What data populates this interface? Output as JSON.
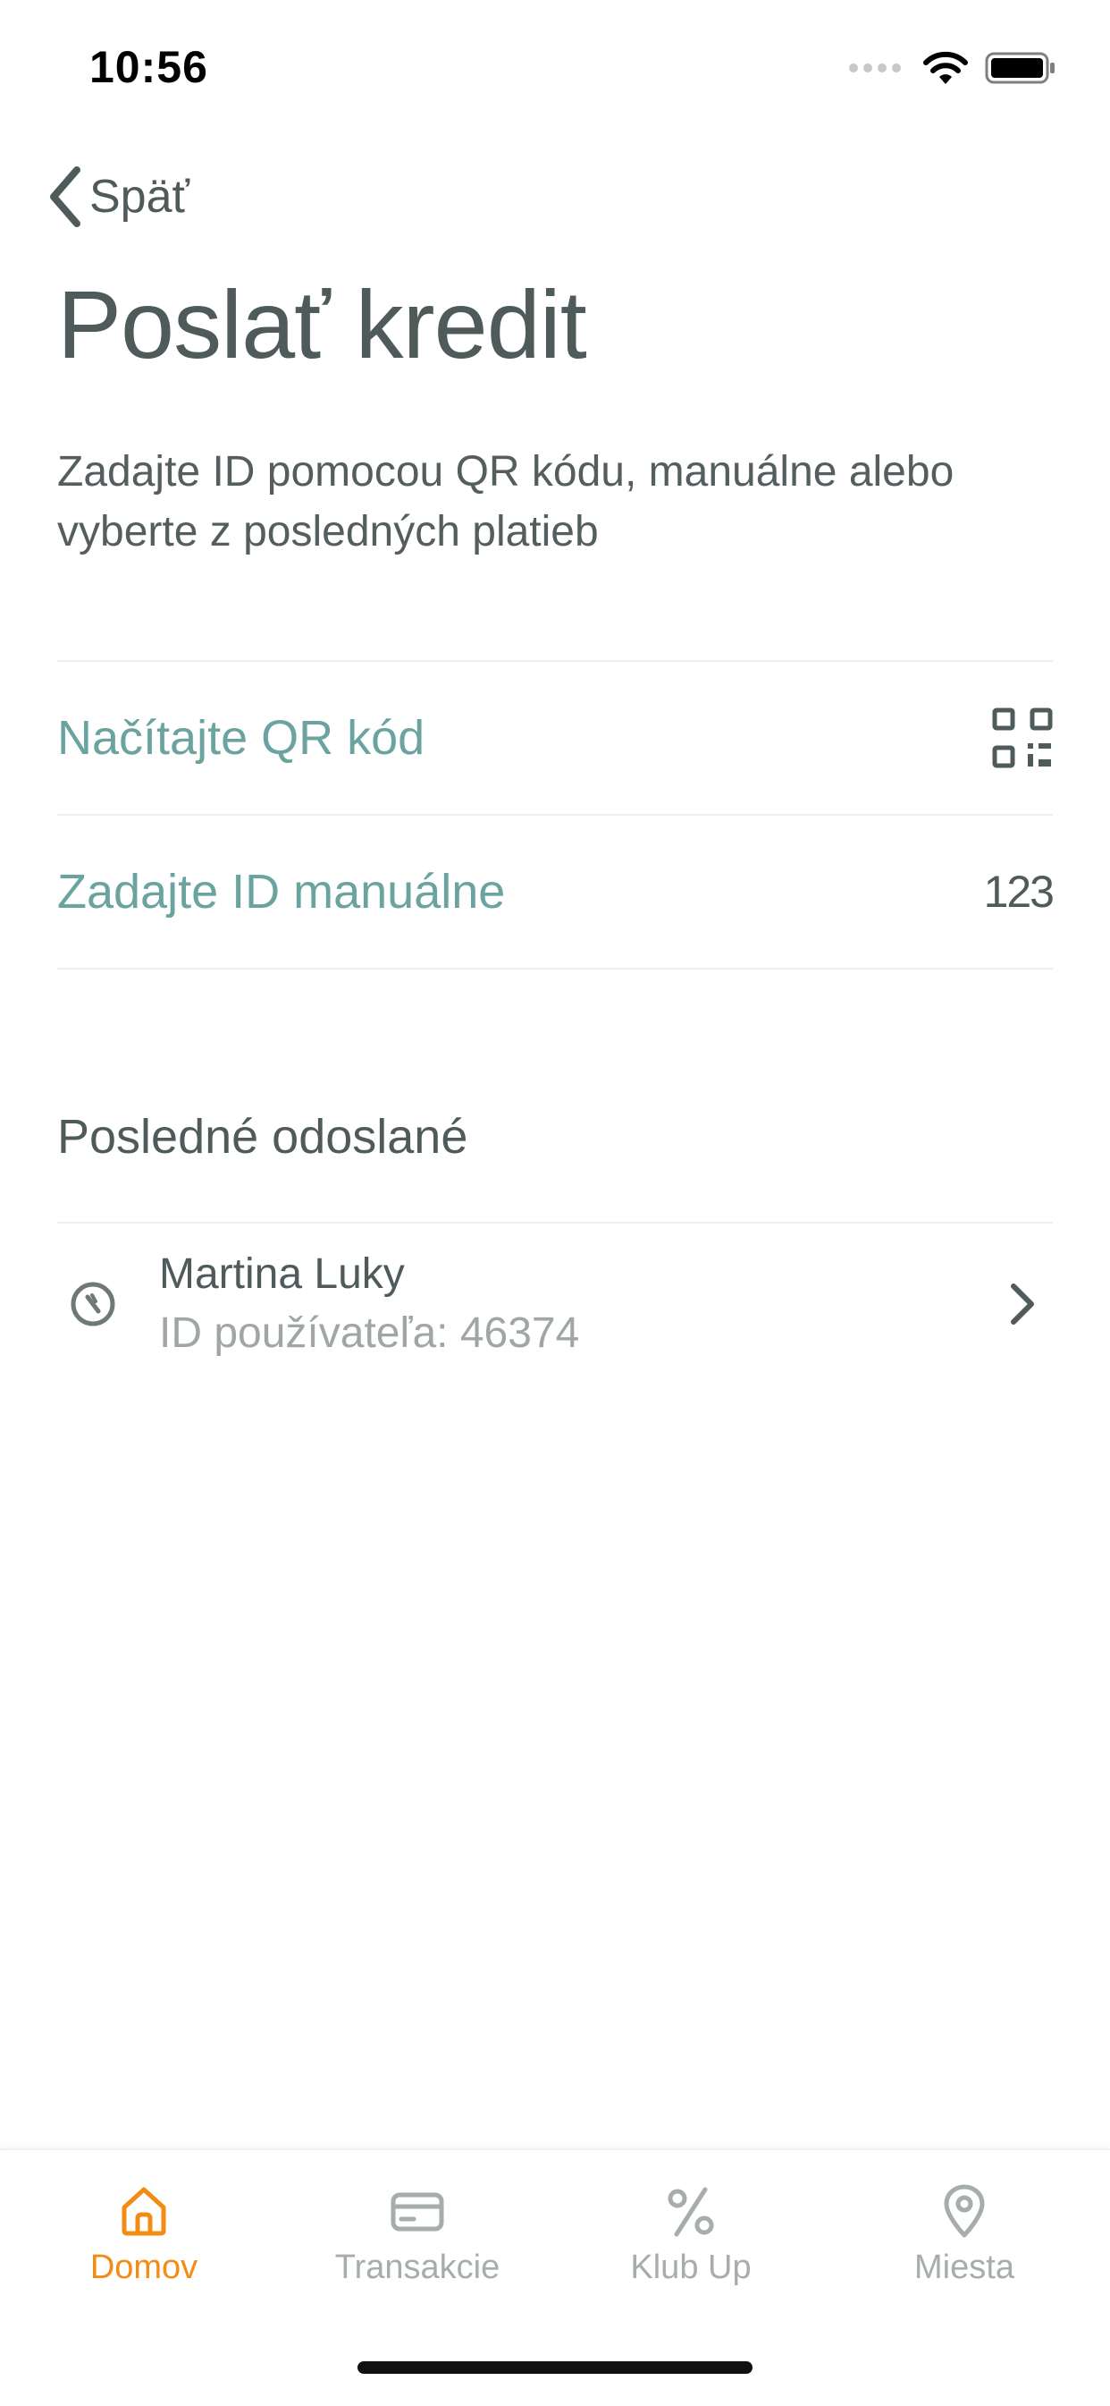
{
  "status_bar": {
    "time": "10:56",
    "icons": [
      "signal-dots-icon",
      "wifi-icon",
      "battery-icon"
    ]
  },
  "nav": {
    "back_label": "Späť"
  },
  "page": {
    "title": "Poslať kredit",
    "instructions": "Zadajte ID pomocou QR kódu, manuálne alebo vyberte z posledných platieb"
  },
  "options": {
    "scan_qr_label": "Načítajte QR kód",
    "scan_qr_icon": "qr-code-icon",
    "manual_id_label": "Zadajte ID manuálne",
    "manual_id_hint": "123"
  },
  "recent": {
    "section_title": "Posledné odoslané",
    "items": [
      {
        "name": "Martina Luky",
        "user_id": "ID používateľa: 46374",
        "icon": "recent-history-icon"
      }
    ]
  },
  "tabs": [
    {
      "label": "Domov",
      "icon": "home-icon",
      "active": true
    },
    {
      "label": "Transakcie",
      "icon": "card-icon",
      "active": false
    },
    {
      "label": "Klub Up",
      "icon": "percent-icon",
      "active": false
    },
    {
      "label": "Miesta",
      "icon": "location-pin-icon",
      "active": false
    }
  ],
  "colors": {
    "accent_teal": "#6aa39f",
    "active_tab": "#f28c14",
    "inactive_tab": "#a7acac",
    "text_primary": "#4f5a5a",
    "text_secondary": "#a0a6a6"
  }
}
